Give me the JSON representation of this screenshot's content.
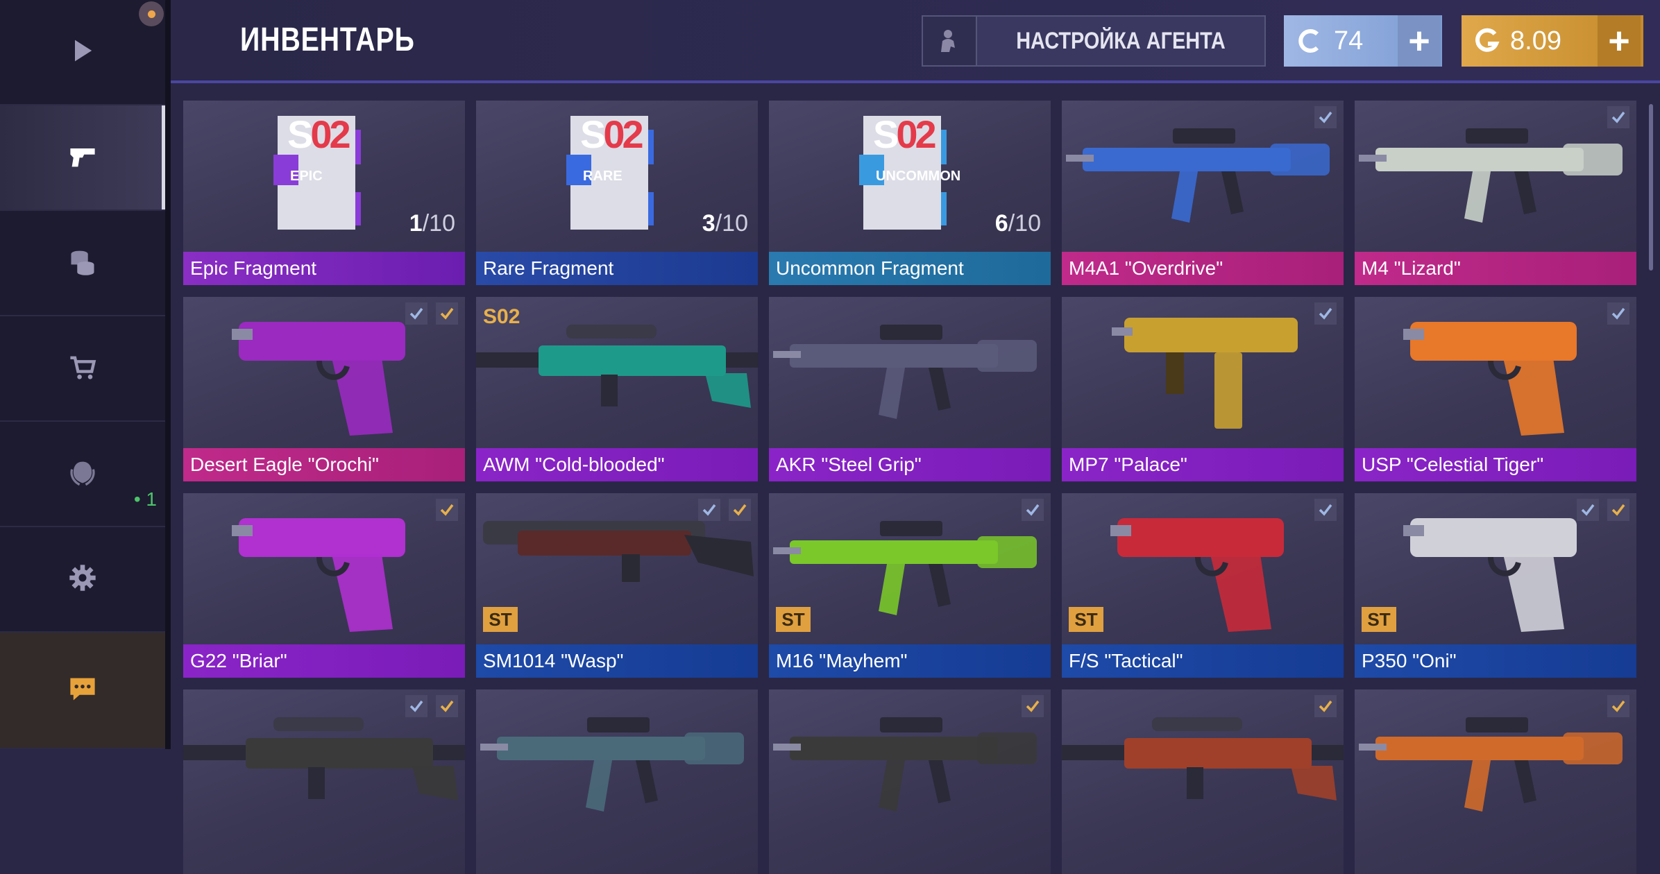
{
  "header": {
    "title": "ИНВЕНТАРЬ",
    "agent_button_label": "НАСТРОЙКА АГЕНТА",
    "credits": "74",
    "gold": "8.09",
    "plus_label": "+"
  },
  "sidebar": {
    "items": [
      {
        "name": "play",
        "icon": "play-icon"
      },
      {
        "name": "inventory",
        "icon": "pistol-icon",
        "active": true
      },
      {
        "name": "coins",
        "icon": "coins-icon"
      },
      {
        "name": "shop",
        "icon": "cart-icon"
      },
      {
        "name": "clan",
        "icon": "laurel-icon",
        "badge": "• 1"
      },
      {
        "name": "settings",
        "icon": "gear-icon"
      },
      {
        "name": "chat",
        "icon": "chat-icon"
      }
    ]
  },
  "colors": {
    "epic": "#8a2ec4",
    "rare": "#2a4aa8",
    "uncommon": "#2a7ab0",
    "pink": "#c02a8a",
    "purple": "#8a24c8",
    "blue": "#1e4aa8",
    "gold": "#e0a040",
    "check_blue": "#9fb7e4",
    "check_gold": "#e8b04a"
  },
  "inventory": [
    {
      "label": "Epic Fragment",
      "rarity": "r-epic",
      "count": "1",
      "total": "10",
      "fragment_rarity": "EPIC",
      "fragment_color": "#8a3cd8"
    },
    {
      "label": "Rare Fragment",
      "rarity": "r-rare",
      "count": "3",
      "total": "10",
      "fragment_rarity": "RARE",
      "fragment_color": "#3a6ae0"
    },
    {
      "label": "Uncommon Fragment",
      "rarity": "r-unc",
      "count": "6",
      "total": "10",
      "fragment_rarity": "UNCOMMON",
      "fragment_color": "#3a9ae0"
    },
    {
      "label": "M4A1 \"Overdrive\"",
      "rarity": "r-pink",
      "checks": [
        "blue"
      ],
      "art": "rifle",
      "gun_color": "#3a6ad0"
    },
    {
      "label": "M4 \"Lizard\"",
      "rarity": "r-pink",
      "checks": [
        "blue"
      ],
      "art": "rifle",
      "gun_color": "#c8d0c8"
    },
    {
      "label": "Desert Eagle \"Orochi\"",
      "rarity": "r-pink",
      "checks": [
        "blue",
        "gold"
      ],
      "art": "pistol",
      "gun_color": "#9a2ac0"
    },
    {
      "label": "AWM \"Cold-blooded\"",
      "rarity": "r-purple",
      "art": "sniper",
      "gun_color": "#1e9a8a",
      "tag": "S02"
    },
    {
      "label": "AKR \"Steel Grip\"",
      "rarity": "r-purple",
      "art": "rifle",
      "gun_color": "#5a5a7a"
    },
    {
      "label": "MP7 \"Palace\"",
      "rarity": "r-purple",
      "checks": [
        "blue"
      ],
      "art": "smg",
      "gun_color": "#c8a030"
    },
    {
      "label": "USP \"Celestial Tiger\"",
      "rarity": "r-purple",
      "checks": [
        "blue"
      ],
      "art": "pistol",
      "gun_color": "#e8782a"
    },
    {
      "label": "G22 \"Briar\"",
      "rarity": "r-purple",
      "checks": [
        "gold"
      ],
      "art": "pistol",
      "gun_color": "#b030d0"
    },
    {
      "label": "SM1014 \"Wasp\"",
      "rarity": "r-blue",
      "checks": [
        "blue",
        "gold"
      ],
      "art": "shotgun",
      "gun_color": "#5a2a2a",
      "st": "ST"
    },
    {
      "label": "M16 \"Mayhem\"",
      "rarity": "r-blue",
      "checks": [
        "blue"
      ],
      "art": "rifle",
      "gun_color": "#7ac82a",
      "st": "ST"
    },
    {
      "label": "F/S \"Tactical\"",
      "rarity": "r-blue",
      "checks": [
        "blue"
      ],
      "art": "pistol",
      "gun_color": "#c82a3a",
      "st": "ST"
    },
    {
      "label": "P350 \"Oni\"",
      "rarity": "r-blue",
      "checks": [
        "blue",
        "gold"
      ],
      "art": "pistol",
      "gun_color": "#d0d0d8",
      "st": "ST"
    },
    {
      "label": "",
      "rarity": "",
      "checks": [
        "blue",
        "gold"
      ],
      "art": "sniper",
      "gun_color": "#3a3a3a"
    },
    {
      "label": "",
      "rarity": "",
      "art": "rifle",
      "gun_color": "#4a6a7a"
    },
    {
      "label": "",
      "rarity": "",
      "checks": [
        "gold"
      ],
      "art": "rifle",
      "gun_color": "#3a3a3a"
    },
    {
      "label": "",
      "rarity": "",
      "checks": [
        "gold"
      ],
      "art": "sniper",
      "gun_color": "#a0402a"
    },
    {
      "label": "",
      "rarity": "",
      "checks": [
        "gold"
      ],
      "art": "rifle",
      "gun_color": "#d06a2a"
    }
  ]
}
